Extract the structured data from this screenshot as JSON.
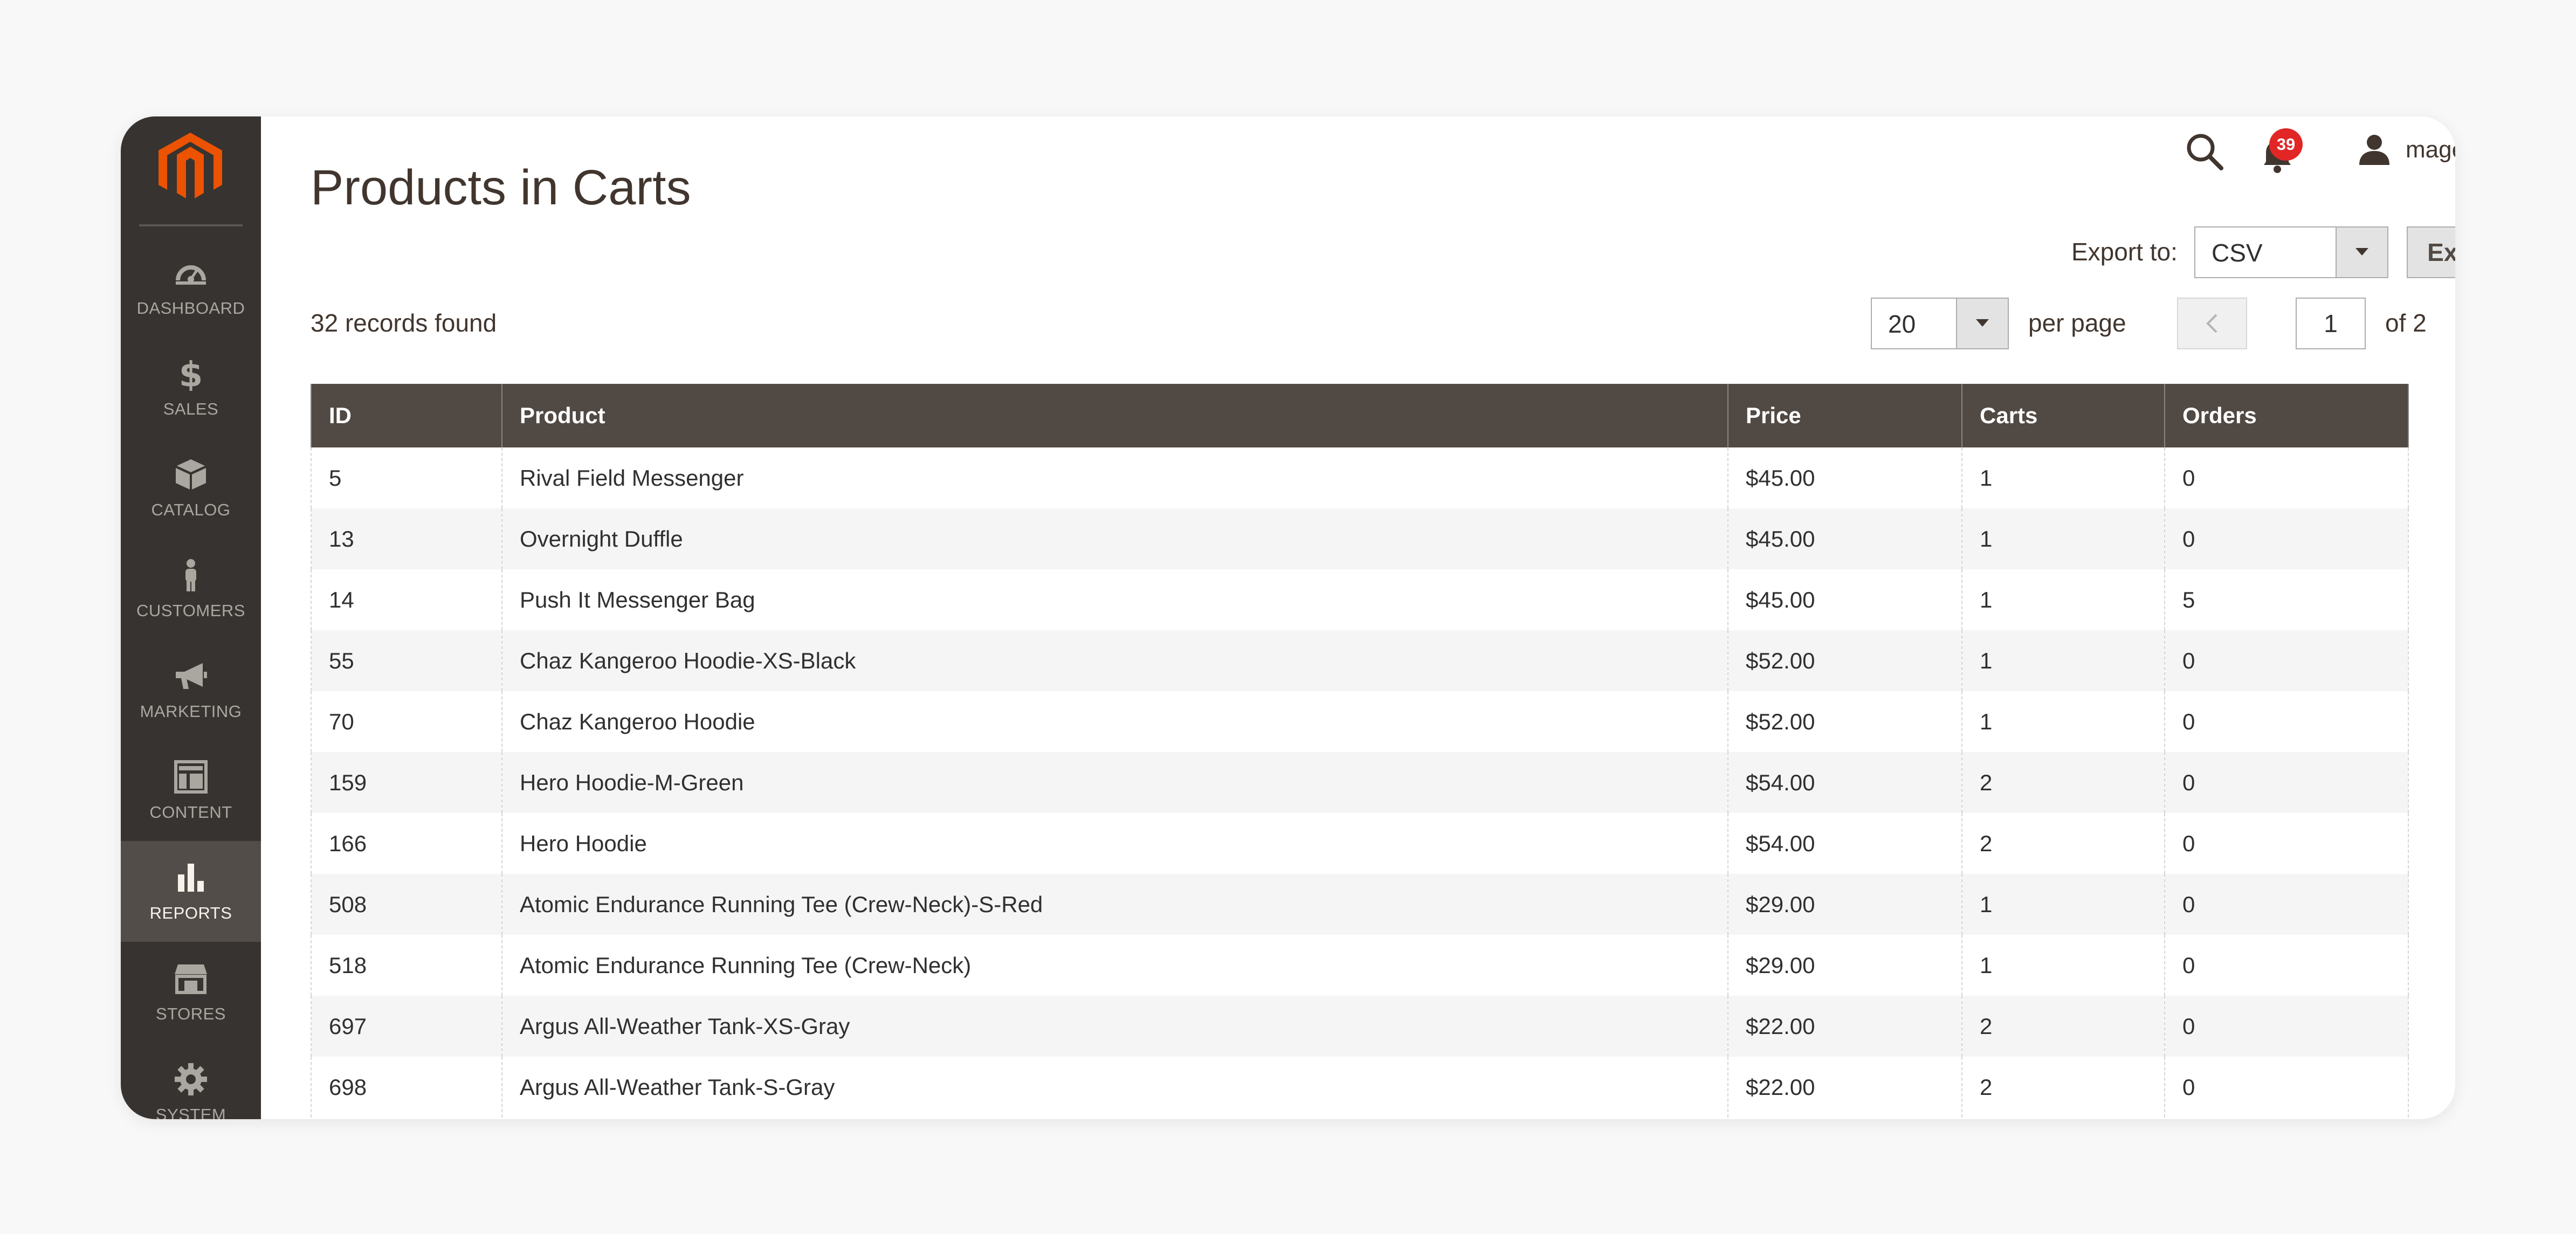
{
  "sidebar": {
    "items": [
      {
        "label": "DASHBOARD",
        "icon": "dashboard-icon"
      },
      {
        "label": "SALES",
        "icon": "dollar-icon"
      },
      {
        "label": "CATALOG",
        "icon": "box-icon"
      },
      {
        "label": "CUSTOMERS",
        "icon": "person-icon"
      },
      {
        "label": "MARKETING",
        "icon": "megaphone-icon"
      },
      {
        "label": "CONTENT",
        "icon": "layout-icon"
      },
      {
        "label": "REPORTS",
        "icon": "bar-chart-icon",
        "active": true
      },
      {
        "label": "STORES",
        "icon": "storefront-icon"
      },
      {
        "label": "SYSTEM",
        "icon": "gear-icon"
      }
    ]
  },
  "header": {
    "title": "Products in Carts",
    "notifications_count": "39",
    "user_name": "magebit"
  },
  "export": {
    "label": "Export to:",
    "format": "CSV",
    "button": "Export"
  },
  "pager": {
    "records": "32 records found",
    "per_page_value": "20",
    "per_page_label": "per page",
    "current_page": "1",
    "total_pages": "of 2"
  },
  "table": {
    "columns": [
      "ID",
      "Product",
      "Price",
      "Carts",
      "Orders"
    ],
    "rows": [
      [
        "5",
        "Rival Field Messenger",
        "$45.00",
        "1",
        "0"
      ],
      [
        "13",
        "Overnight Duffle",
        "$45.00",
        "1",
        "0"
      ],
      [
        "14",
        "Push It Messenger Bag",
        "$45.00",
        "1",
        "5"
      ],
      [
        "55",
        "Chaz Kangeroo Hoodie-XS-Black",
        "$52.00",
        "1",
        "0"
      ],
      [
        "70",
        "Chaz Kangeroo Hoodie",
        "$52.00",
        "1",
        "0"
      ],
      [
        "159",
        "Hero Hoodie-M-Green",
        "$54.00",
        "2",
        "0"
      ],
      [
        "166",
        "Hero Hoodie",
        "$54.00",
        "2",
        "0"
      ],
      [
        "508",
        "Atomic Endurance Running Tee (Crew-Neck)-S-Red",
        "$29.00",
        "1",
        "0"
      ],
      [
        "518",
        "Atomic Endurance Running Tee (Crew-Neck)",
        "$29.00",
        "1",
        "0"
      ],
      [
        "697",
        "Argus All-Weather Tank-XS-Gray",
        "$22.00",
        "2",
        "0"
      ],
      [
        "698",
        "Argus All-Weather Tank-S-Gray",
        "$22.00",
        "2",
        "0"
      ]
    ]
  },
  "colors": {
    "sidebar_bg": "#373330",
    "sidebar_active": "#524d49",
    "table_header": "#514943",
    "brand_orange": "#eb5202",
    "badge_red": "#e22626"
  }
}
